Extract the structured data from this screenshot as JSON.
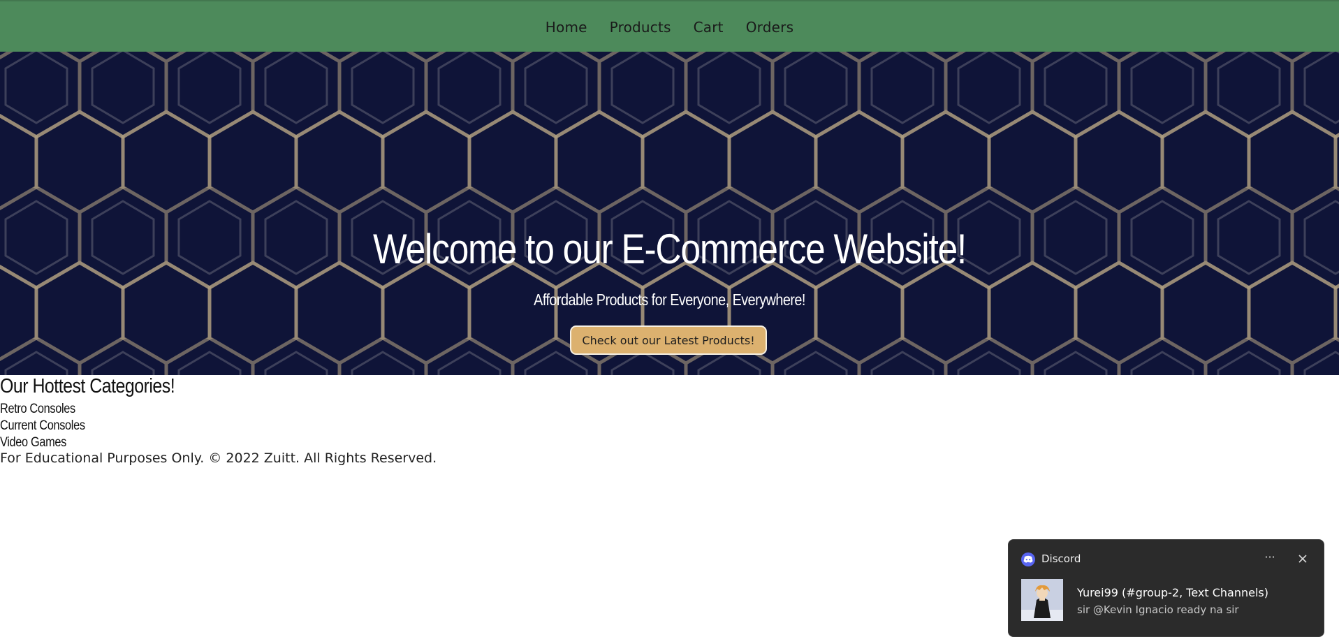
{
  "navbar": {
    "links": [
      "Home",
      "Products",
      "Cart",
      "Orders"
    ],
    "background": "#4d8a5b"
  },
  "hero": {
    "title": "Welcome to our E-Commerce Website!",
    "subtitle": "Affordable Products for Everyone, Everywhere!",
    "button_label": "Check out our Latest Products!",
    "background": "#0f1438",
    "button_color": "#dcb16f"
  },
  "categories": {
    "heading": "Our Hottest Categories!",
    "items": [
      "Retro Consoles",
      "Current Consoles",
      "Video Games"
    ]
  },
  "footer": {
    "text": "For Educational Purposes Only. © 2022 Zuitt. All Rights Reserved."
  },
  "notification": {
    "app_name": "Discord",
    "app_icon": "discord-icon",
    "title": "Yurei99 (#group-2, Text Channels)",
    "message": "sir @Kevin Ignacio ready na sir",
    "more_label": "···",
    "accent": "#5865f2"
  }
}
